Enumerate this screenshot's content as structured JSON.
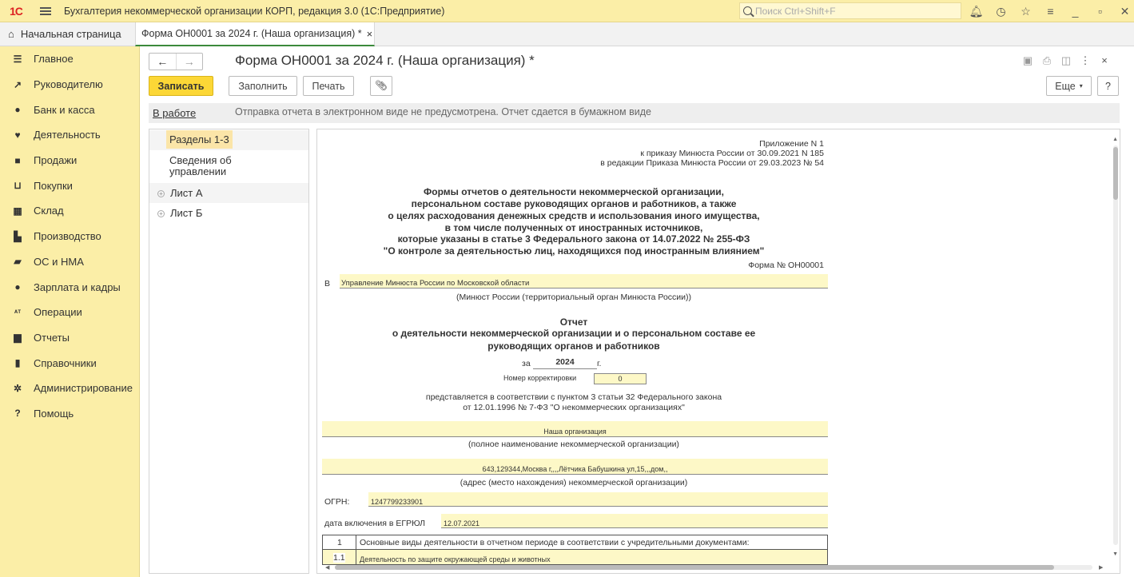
{
  "window": {
    "logo": "1С",
    "title": "Бухгалтерия некоммерческой организации КОРП, редакция 3.0  (1С:Предприятие)",
    "search_placeholder": "Поиск Ctrl+Shift+F",
    "icons": [
      "bell-icon",
      "history-icon",
      "star-icon",
      "settings-icon",
      "minimize-icon",
      "restore-icon",
      "close-icon"
    ]
  },
  "tabs": {
    "home_label": "Начальная страница",
    "doc_label": "Форма ОН0001 за 2024 г. (Наша организация) *",
    "close_glyph": "×"
  },
  "sidebar": {
    "items": [
      {
        "label": "Главное",
        "icon": "menu-icon",
        "glyph": "☰"
      },
      {
        "label": "Руководителю",
        "icon": "trend-icon",
        "glyph": "↗"
      },
      {
        "label": "Банк и касса",
        "icon": "coin-icon",
        "glyph": "●"
      },
      {
        "label": "Деятельность",
        "icon": "hands-icon",
        "glyph": "♥"
      },
      {
        "label": "Продажи",
        "icon": "bag-icon",
        "glyph": "■"
      },
      {
        "label": "Покупки",
        "icon": "cart-icon",
        "glyph": "⊔"
      },
      {
        "label": "Склад",
        "icon": "warehouse-icon",
        "glyph": "▦"
      },
      {
        "label": "Производство",
        "icon": "factory-icon",
        "glyph": "▙"
      },
      {
        "label": "ОС и НМА",
        "icon": "truck-icon",
        "glyph": "▰"
      },
      {
        "label": "Зарплата и кадры",
        "icon": "person-icon",
        "glyph": "●"
      },
      {
        "label": "Операции",
        "icon": "dtkt-icon",
        "glyph": "ᴬᵀ"
      },
      {
        "label": "Отчеты",
        "icon": "bar-chart-icon",
        "glyph": "▆"
      },
      {
        "label": "Справочники",
        "icon": "book-icon",
        "glyph": "▮"
      },
      {
        "label": "Администрирование",
        "icon": "gear-icon",
        "glyph": "✲"
      },
      {
        "label": "Помощь",
        "icon": "help-icon",
        "glyph": "?"
      }
    ]
  },
  "header": {
    "title": "Форма ОН0001 за 2024 г. (Наша организация) *",
    "save_label": "Записать",
    "fill_label": "Заполнить",
    "print_label": "Печать",
    "more_label": "Еще",
    "help_label": "?"
  },
  "status": {
    "link": "В работе",
    "text": "Отправка отчета в электронном виде не предусмотрена. Отчет сдается в бумажном виде"
  },
  "sections": [
    {
      "label": "Разделы 1-3"
    },
    {
      "label": "Сведения об управлении"
    },
    {
      "label": "Лист А"
    },
    {
      "label": "Лист Б"
    }
  ],
  "document": {
    "appendix": [
      "Приложение N 1",
      "к приказу Минюста России от 30.09.2021 N 185",
      "в редакции Приказа Минюста России от 29.03.2023 № 54"
    ],
    "heading": [
      "Формы отчетов о деятельности некоммерческой организации,",
      "персональном составе руководящих органов и работников, а также",
      "о целях расходования денежных средств и использования иного имущества,",
      "в том числе полученных от иностранных источников,",
      "которые указаны в статье 3 Федерального закона от 14.07.2022 № 255-ФЗ",
      "\"О контроле за деятельностью лиц, находящихся под иностранным влиянием\""
    ],
    "form_no": "Форма № ОН00001",
    "to_prefix": "В",
    "to_value": "Управление Минюста России по Московской области",
    "to_caption": "(Минюст России (территориальный орган Минюста России))",
    "report_title": [
      "Отчет",
      "о деятельности некоммерческой организации и о персональном составе ее",
      "руководящих органов и работников"
    ],
    "period_prefix": "за",
    "year": "2024",
    "year_suffix": "г.",
    "correction_label": "Номер корректировки",
    "correction_value": "0",
    "basis": [
      "представляется в соответствии с пунктом 3 статьи 32 Федерального закона",
      "от 12.01.1996 № 7-ФЗ \"О некоммерческих организациях\""
    ],
    "org_name": "Наша организация",
    "org_caption": "(полное наименование некоммерческой организации)",
    "address": "643,129344,Москва г,,,,Лётчика Бабушкина ул,15,,,дом,,",
    "address_caption": "(адрес (место нахождения) некоммерческой организации)",
    "ogrn_label": "ОГРН:",
    "ogrn_value": "1247799233901",
    "egrul_label": "дата включения в ЕГРЮЛ",
    "egrul_value": "12.07.2021",
    "table": [
      {
        "no": "1",
        "text": "Основные виды деятельности в отчетном периоде в соответствии с учредительными документами:"
      },
      {
        "no": "1.1",
        "text": "Деятельность по защите окружающей среды и животных"
      }
    ]
  }
}
